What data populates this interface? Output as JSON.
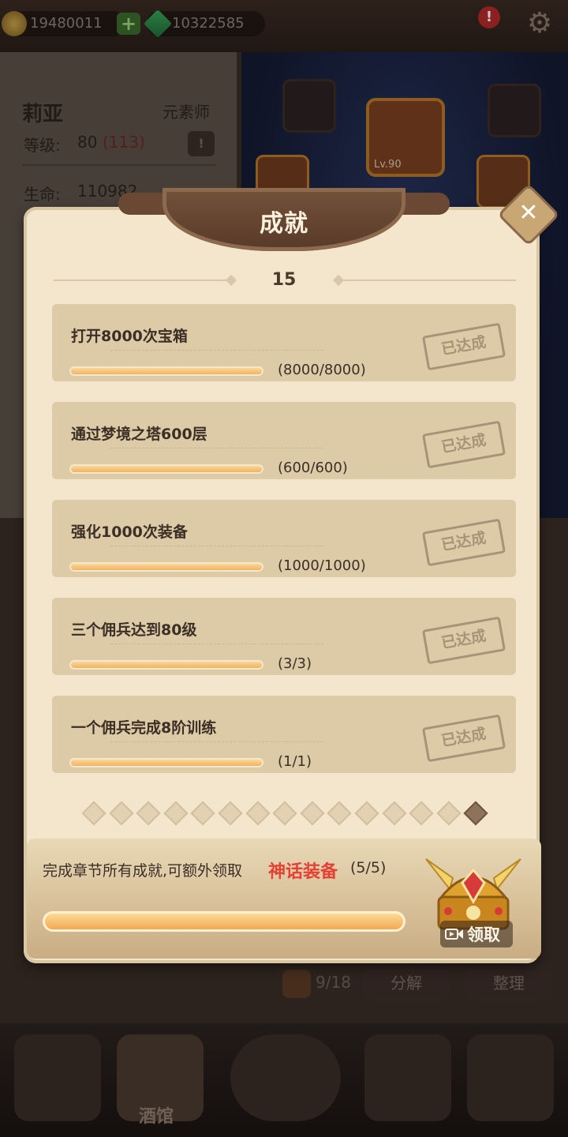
{
  "top_bar": {
    "gold": "19480011",
    "gems": "10322585",
    "plus_label": "+"
  },
  "hero": {
    "name": "莉亚",
    "class": "元素师",
    "level_label": "等级:",
    "level": "80",
    "level_bonus": "(113)",
    "hp_label": "生命:",
    "hp": "110982",
    "equip_level": "Lv.90"
  },
  "inventory": {
    "bag_count": "9/18",
    "decompose_label": "分解",
    "sort_label": "整理"
  },
  "nav": {
    "tavern_label": "酒馆"
  },
  "modal": {
    "title": "成就",
    "close_glyph": "✕",
    "count": "15",
    "achievements": [
      {
        "title": "打开8000次宝箱",
        "progress": "(8000/8000)",
        "fraction": 1.0,
        "status": "已达成"
      },
      {
        "title": "通过梦境之塔600层",
        "progress": "(600/600)",
        "fraction": 1.0,
        "status": "已达成"
      },
      {
        "title": "强化1000次装备",
        "progress": "(1000/1000)",
        "fraction": 1.0,
        "status": "已达成"
      },
      {
        "title": "三个佣兵达到80级",
        "progress": "(3/3)",
        "fraction": 1.0,
        "status": "已达成"
      },
      {
        "title": "一个佣兵完成8阶训练",
        "progress": "(1/1)",
        "fraction": 1.0,
        "status": "已达成"
      }
    ],
    "pagination": {
      "total_pages": 15,
      "current_page": 15
    },
    "reward": {
      "text": "完成章节所有成就,可额外领取",
      "highlight": "神话装备",
      "count": "(5/5)",
      "fraction": 1.0,
      "claim_label": "领取"
    }
  },
  "colors": {
    "parchment": "#f3e6cd",
    "card": "#ddcaa7",
    "bar_fill": "#f0a953",
    "highlight_red": "#e54035",
    "banner_brown": "#573a29"
  }
}
